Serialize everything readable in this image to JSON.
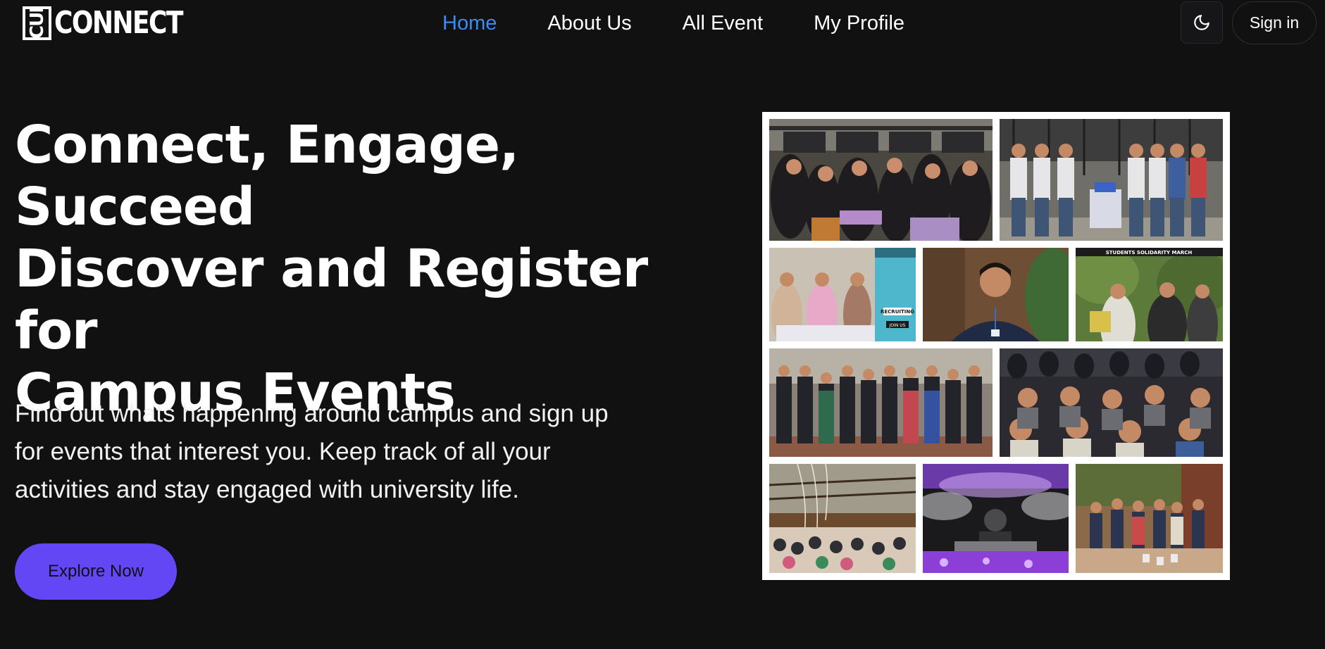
{
  "brand": {
    "logo_mark": "CUI",
    "logo_text": "CONNECT"
  },
  "nav": {
    "links": [
      {
        "label": "Home",
        "active": true
      },
      {
        "label": "About Us",
        "active": false
      },
      {
        "label": "All Event",
        "active": false
      },
      {
        "label": "My Profile",
        "active": false
      }
    ],
    "theme_toggle_icon": "moon-icon",
    "signin_label": "Sign in"
  },
  "hero": {
    "title_lines": [
      "Connect, Engage,",
      "Succeed",
      "Discover and Register for",
      "Campus Events"
    ],
    "description": "Find out whats happening around campus and sign up for events that interest you. Keep track of all your activities and stay engaged with university life.",
    "cta_label": "Explore Now"
  },
  "collage": {
    "photo_signage": [
      "STUDENTS SOLIDARITY MARCH",
      "RECRUITING",
      "JOIN US"
    ]
  },
  "colors": {
    "background": "#111112",
    "accent_link": "#3b8bf5",
    "cta": "#6347f5",
    "text": "#ffffff"
  }
}
